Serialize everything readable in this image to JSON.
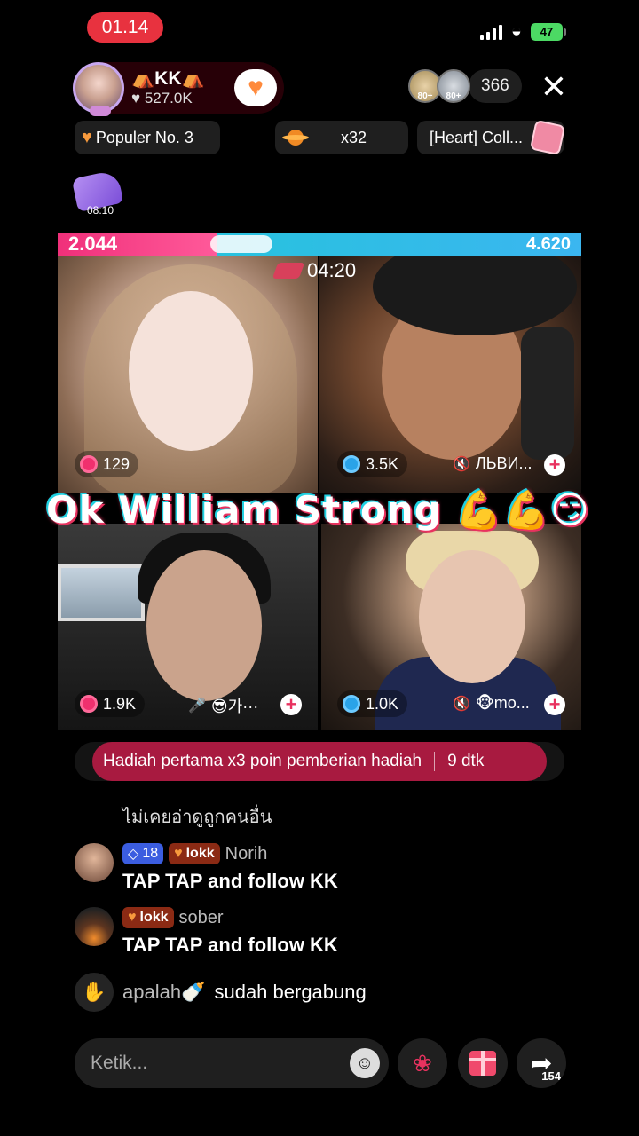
{
  "status_bar": {
    "time": "01.14",
    "battery": "47"
  },
  "host": {
    "name": "⛺️KK⛺️",
    "likes": "♥ 527.0K",
    "follow_count": "15"
  },
  "viewers": {
    "badge_a": "80+",
    "badge_b": "80+",
    "count": "366"
  },
  "info_chips": {
    "popular": "Populer No. 3",
    "multiplier": "x32",
    "collection": "[Heart] Coll..."
  },
  "timer_badge": "08:10",
  "battle": {
    "score_left": "2.044",
    "score_right": "4.620",
    "timer": "04:20",
    "overlay_text": "Ok William Strong 💪💪😏"
  },
  "tiles": [
    {
      "score": "129",
      "color": "pink"
    },
    {
      "score": "3.5K",
      "color": "blue",
      "name": "ЛЬВИ..."
    },
    {
      "score": "1.9K",
      "color": "pink",
      "name": "😎가···"
    },
    {
      "score": "1.0K",
      "color": "blue",
      "name": "🐵mo..."
    }
  ],
  "banner": {
    "text": "Hadiah pertama x3 poin pemberian hadiah",
    "countdown": "9 dtk"
  },
  "chat": {
    "thai_line": "ไม่เคยอ่าดูถูกคนอื่น",
    "messages": [
      {
        "level": "18",
        "fan_badge": "lokk",
        "user": "Norih",
        "text": "TAP TAP and  follow KK"
      },
      {
        "fan_badge": "lokk",
        "user": "sober",
        "text": "TAP TAP and  follow KK"
      }
    ],
    "join": {
      "user": "apalah🍼",
      "text": "sudah bergabung"
    }
  },
  "bottom_bar": {
    "placeholder": "Ketik...",
    "share_count": "154"
  },
  "colors": {
    "accent": "#e8325f",
    "battle_left": "#f0307a",
    "battle_right": "#1fc7d6",
    "banner": "#a81a40"
  }
}
